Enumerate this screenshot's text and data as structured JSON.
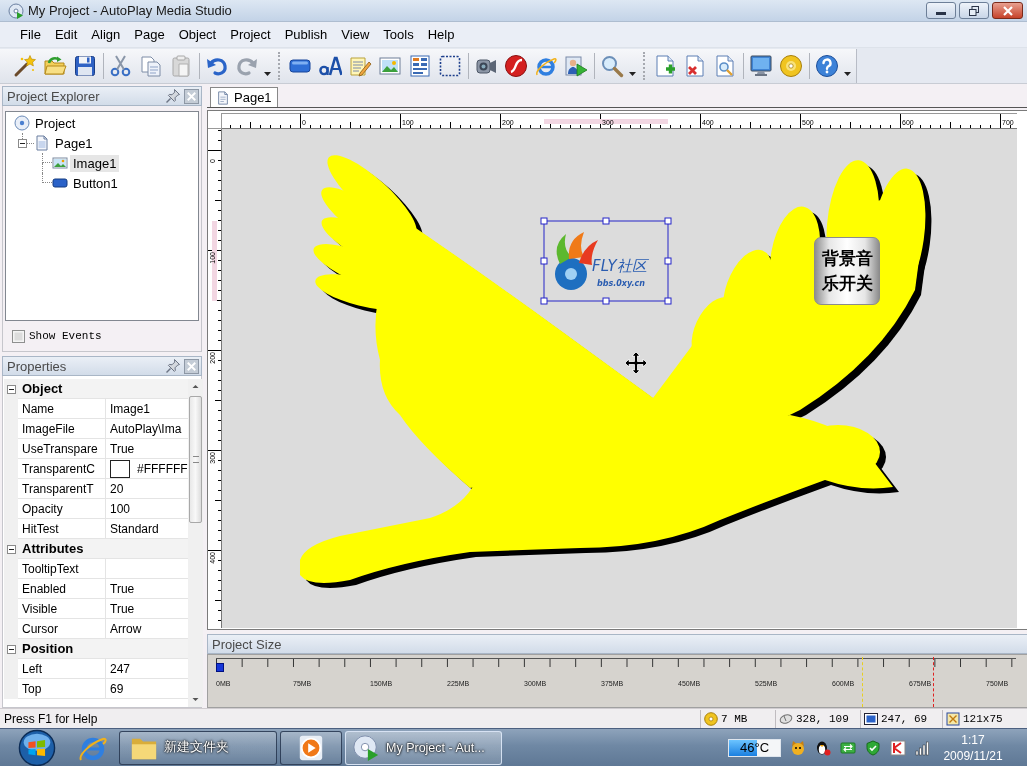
{
  "window": {
    "title": "My Project - AutoPlay Media Studio"
  },
  "menu": [
    "File",
    "Edit",
    "Align",
    "Page",
    "Object",
    "Project",
    "Publish",
    "View",
    "Tools",
    "Help"
  ],
  "project_explorer": {
    "title": "Project Explorer",
    "tree": [
      {
        "label": "Project",
        "kind": "project",
        "selected": false,
        "children": [
          {
            "label": "Page1",
            "kind": "page",
            "selected": false,
            "expanded": true,
            "children": [
              {
                "label": "Image1",
                "kind": "image",
                "selected": true
              },
              {
                "label": "Button1",
                "kind": "button",
                "selected": false
              }
            ]
          }
        ]
      }
    ],
    "show_events": {
      "label": "Show Events",
      "checked": false
    }
  },
  "properties": {
    "title": "Properties",
    "rows": [
      {
        "kind": "category",
        "label": "Object",
        "expanded": true
      },
      {
        "kind": "property",
        "name": "Name",
        "value": "Image1"
      },
      {
        "kind": "property",
        "name": "ImageFile",
        "value": "AutoPlay\\Ima"
      },
      {
        "kind": "property",
        "name": "UseTranspare",
        "value": "True"
      },
      {
        "kind": "color",
        "name": "TransparentC",
        "value": "#FFFFFF",
        "color": "#ffffff"
      },
      {
        "kind": "property",
        "name": "TransparentT",
        "value": "20"
      },
      {
        "kind": "property",
        "name": "Opacity",
        "value": "100"
      },
      {
        "kind": "property",
        "name": "HitTest",
        "value": "Standard"
      },
      {
        "kind": "category",
        "label": "Attributes",
        "expanded": true
      },
      {
        "kind": "property",
        "name": "TooltipText"
      },
      {
        "kind": "property",
        "name": "Enabled",
        "value": "True"
      },
      {
        "kind": "property",
        "name": "Visible",
        "value": "True"
      },
      {
        "kind": "property",
        "name": "Cursor",
        "value": "Arrow"
      },
      {
        "kind": "category",
        "label": "Position",
        "expanded": true
      },
      {
        "kind": "property",
        "name": "Left",
        "value": "247"
      },
      {
        "kind": "property",
        "name": "Top",
        "value": "69"
      }
    ]
  },
  "document_tabs": [
    {
      "label": "Page1",
      "selected": true
    }
  ],
  "rulers": {
    "horizontal": [
      "0",
      "100",
      "200",
      "300",
      "400",
      "500",
      "600",
      "700"
    ],
    "vertical": [
      "0",
      "100",
      "200",
      "300",
      "400"
    ]
  },
  "canvas": {
    "objects": [
      {
        "kind": "image",
        "selected": true,
        "logo_text": "FLY社区",
        "logo_subtext": "bbs.0xy.cn"
      },
      {
        "kind": "button",
        "selected": false,
        "label": "背景音乐开关"
      }
    ]
  },
  "project_size": {
    "title": "Project Size",
    "level": 0.01,
    "scale": [
      "0MB",
      "75MB",
      "150MB",
      "225MB",
      "300MB",
      "375MB",
      "450MB",
      "525MB",
      "600MB",
      "675MB",
      "750MB"
    ],
    "markers": [
      {
        "level": 0.808,
        "color": "#e8d020"
      },
      {
        "level": 0.896,
        "color": "#e02020"
      }
    ]
  },
  "status_bar": {
    "help": "Press F1 for Help",
    "panes": [
      {
        "kind": "size",
        "text": "7 MB"
      },
      {
        "kind": "cursor",
        "text": "328, 109"
      },
      {
        "kind": "position",
        "text": "247, 69"
      },
      {
        "kind": "dimensions",
        "text": "121x75"
      }
    ]
  },
  "taskbar": {
    "buttons": [
      {
        "kind": "folder",
        "label": "新建文件夹",
        "selected": false
      },
      {
        "kind": "media",
        "selected": false
      },
      {
        "kind": "app",
        "label": "My Project - Aut...",
        "selected": true
      }
    ],
    "temperature": {
      "reading": "46°C",
      "level": 0.55
    },
    "clock": {
      "time": "1:17",
      "date": "2009/11/21"
    }
  }
}
